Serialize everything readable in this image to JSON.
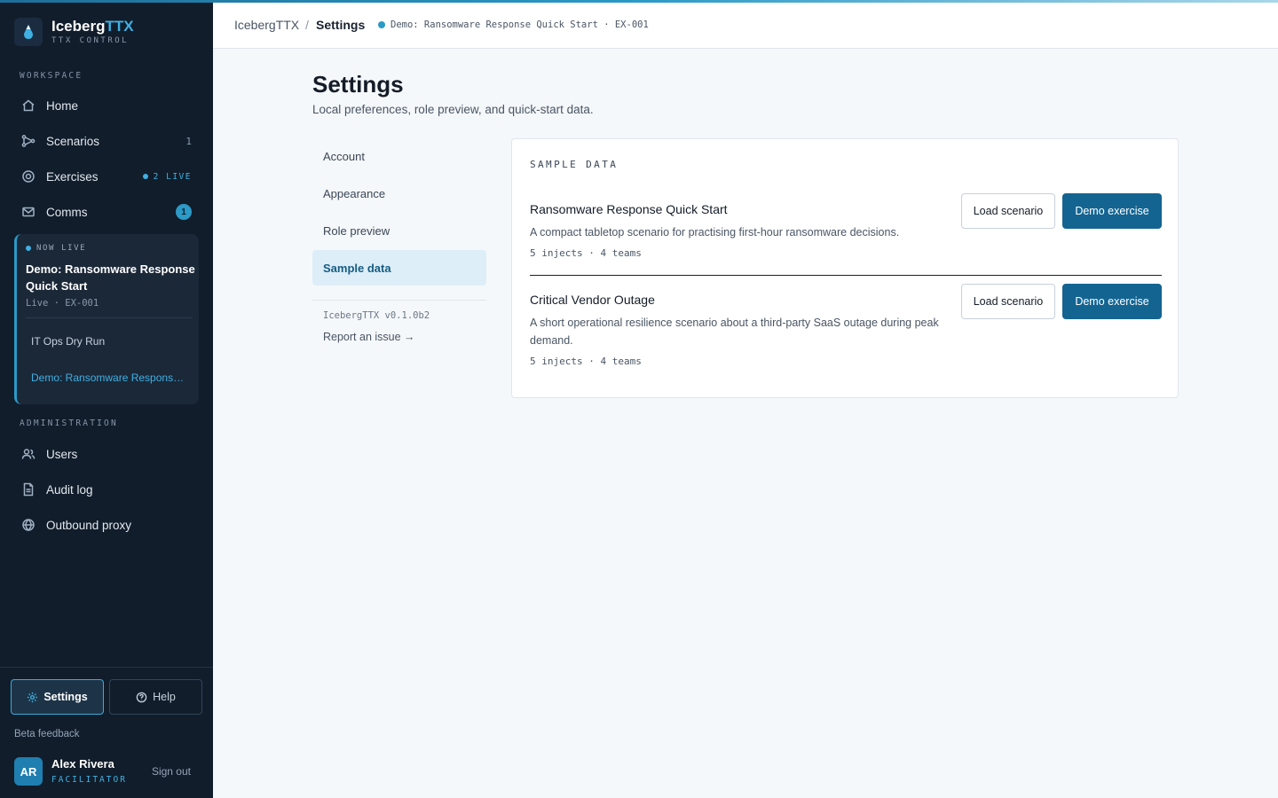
{
  "app": {
    "brand_name_main": "Iceberg",
    "brand_name_accent": "TTX",
    "brand_sub": "TTX CONTROL"
  },
  "sidebar": {
    "workspace_label": "WORKSPACE",
    "items": [
      {
        "label": "Home",
        "icon": "home-icon"
      },
      {
        "label": "Scenarios",
        "icon": "scenarios-icon",
        "count": "1"
      },
      {
        "label": "Exercises",
        "icon": "exercises-icon",
        "live": "2 LIVE"
      },
      {
        "label": "Comms",
        "icon": "mail-icon",
        "badge": "1"
      }
    ],
    "live_card": {
      "tag": "NOW LIVE",
      "title": "Demo: Ransomware Response Quick Start",
      "meta": "Live · EX-001",
      "sub_items": [
        "IT Ops Dry Run",
        "Demo: Ransomware Response Quick Start"
      ]
    },
    "admin_label": "ADMINISTRATION",
    "admin_items": [
      {
        "label": "Users",
        "icon": "users-icon"
      },
      {
        "label": "Audit log",
        "icon": "document-icon"
      },
      {
        "label": "Outbound proxy",
        "icon": "globe-icon"
      }
    ],
    "footer": {
      "settings_label": "Settings",
      "help_label": "Help",
      "beta_label": "Beta feedback",
      "user_initials": "AR",
      "user_name": "Alex Rivera",
      "user_role": "FACILITATOR",
      "sign_out": "Sign out"
    }
  },
  "topbar": {
    "breadcrumb_root": "IcebergTTX",
    "breadcrumb_sep": "/",
    "breadcrumb_current": "Settings",
    "exercise_pill": "Demo: Ransomware Response Quick Start · EX-001"
  },
  "main": {
    "title": "Settings",
    "subtitle": "Local preferences, role preview, and quick-start data.",
    "settings_nav": [
      "Account",
      "Appearance",
      "Role preview",
      "Sample data"
    ],
    "active_nav": "Sample data",
    "version": "IcebergTTX v0.1.0b2",
    "report_issue": "Report an issue →",
    "panel": {
      "label": "SAMPLE DATA",
      "scenarios": [
        {
          "title": "Ransomware Response Quick Start",
          "description": "A compact tabletop scenario for practising first-hour ransomware decisions.",
          "meta": "5 injects · 4 teams",
          "load_label": "Load scenario",
          "demo_label": "Demo exercise"
        },
        {
          "title": "Critical Vendor Outage",
          "description": "A short operational resilience scenario about a third-party SaaS outage during peak demand.",
          "meta": "5 injects · 4 teams",
          "load_label": "Load scenario",
          "demo_label": "Demo exercise"
        }
      ]
    }
  },
  "colors": {
    "sidebar_bg": "#111d2b",
    "accent": "#2b9ac7",
    "primary_button": "#136491",
    "active_nav_bg": "#ddeef8"
  }
}
